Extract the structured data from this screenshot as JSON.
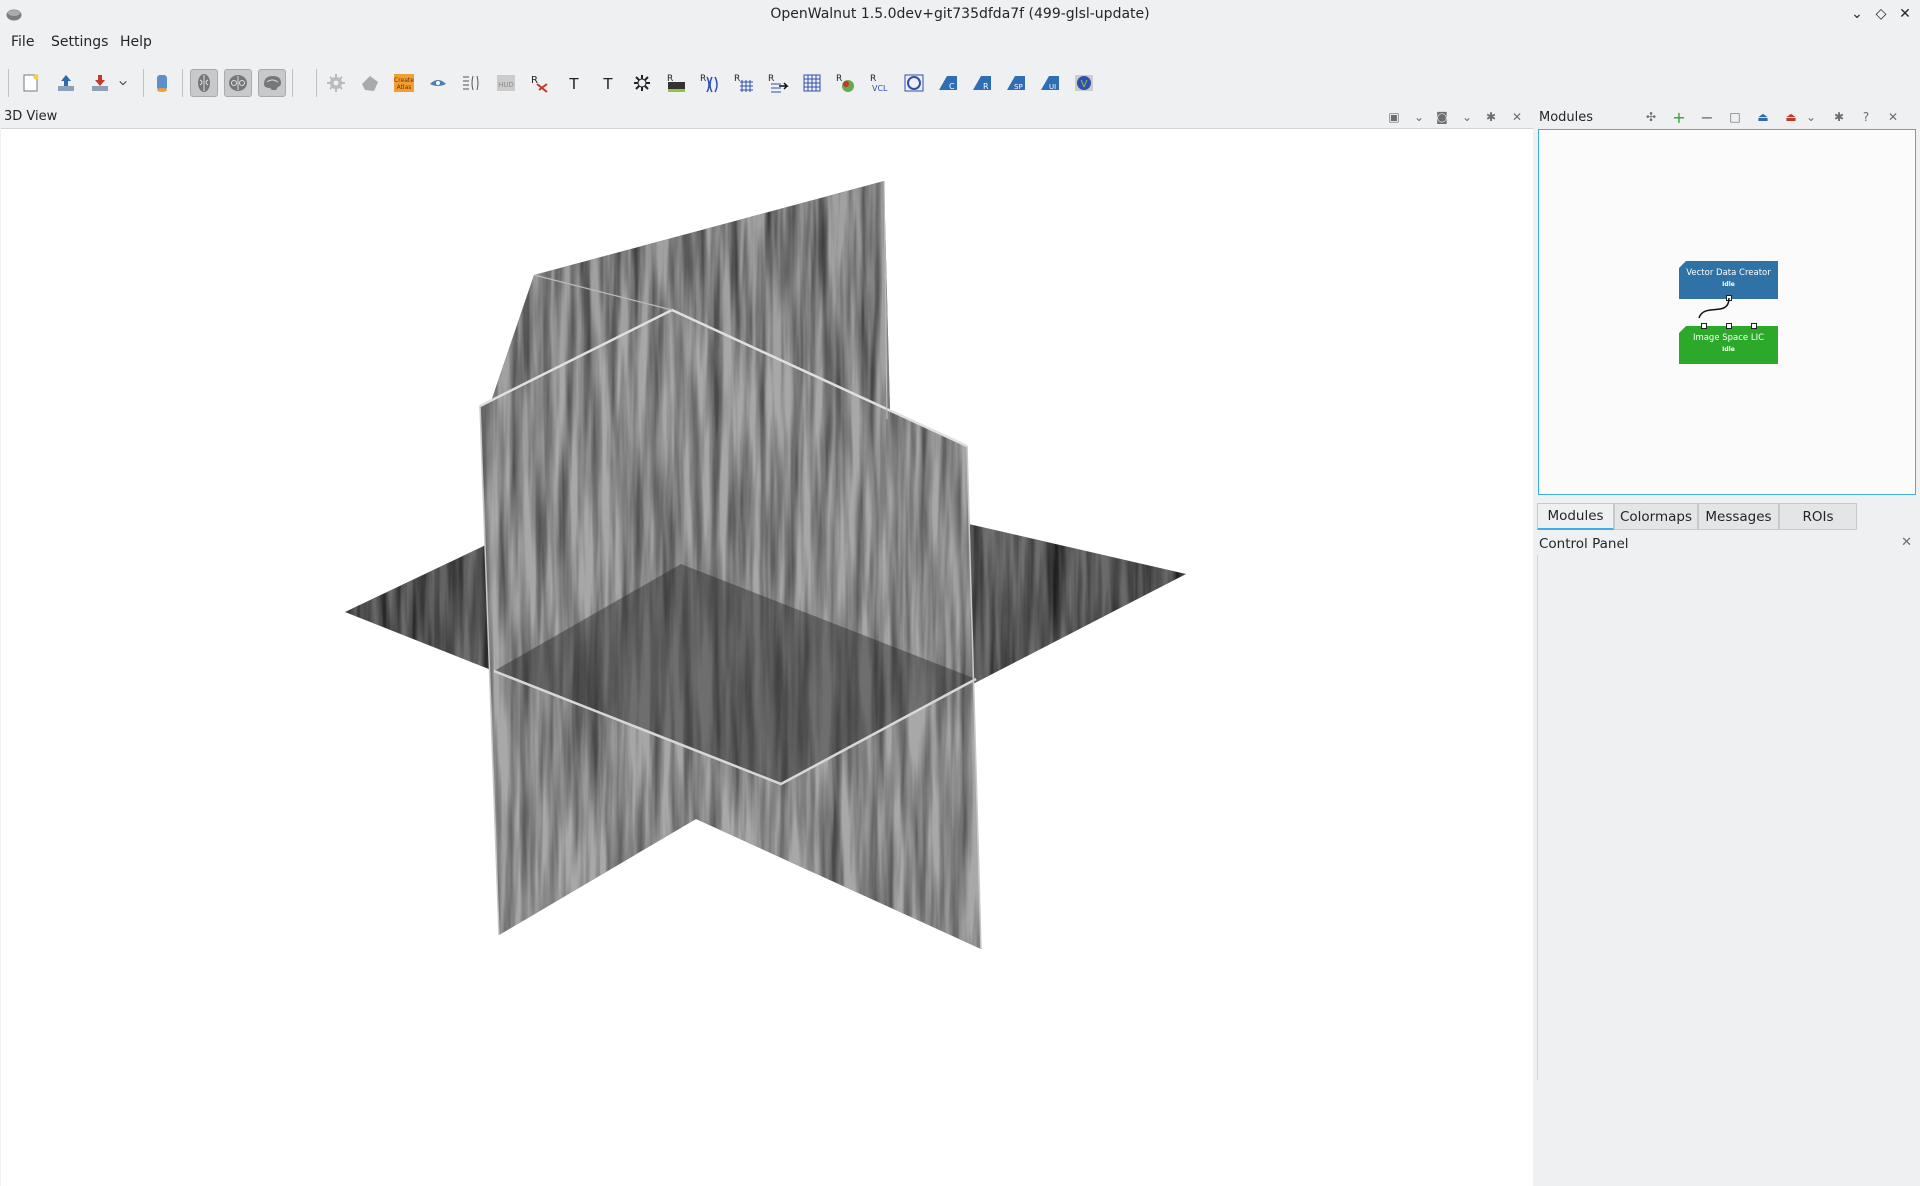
{
  "window": {
    "title": "OpenWalnut 1.5.0dev+git735dfda7f (499-glsl-update)",
    "controls": {
      "minimize": "⌄",
      "maximize": "◇",
      "close": "✕"
    }
  },
  "menu": {
    "items": [
      "File",
      "Settings",
      "Help"
    ]
  },
  "toolbar": {
    "buttons": [
      {
        "icon": "new-project-icon"
      },
      {
        "icon": "load-icon"
      },
      {
        "icon": "save-icon"
      },
      {
        "icon": "dropdown-arrow-icon"
      },
      {
        "icon": "database-icon"
      },
      {
        "icon": "brain-axial-icon",
        "pressed": true
      },
      {
        "icon": "brain-coronal-icon",
        "pressed": true
      },
      {
        "icon": "brain-sagittal-icon",
        "pressed": true
      },
      {
        "icon": "gear-module-icon"
      },
      {
        "icon": "sphere-module-icon"
      },
      {
        "icon": "create-atlas-icon",
        "text": "Create Atlas"
      },
      {
        "icon": "eye-module-icon"
      },
      {
        "icon": "matrix-module-icon"
      },
      {
        "icon": "hud-icon",
        "text": "HUD"
      },
      {
        "icon": "r-fibers-icon",
        "text": "R"
      },
      {
        "icon": "text-icon",
        "text": "T"
      },
      {
        "icon": "text-icon-2",
        "text": "T"
      },
      {
        "icon": "isosurface-icon"
      },
      {
        "icon": "r-image-icon",
        "text": "R"
      },
      {
        "icon": "r-vector-icon",
        "text": "R"
      },
      {
        "icon": "r-grid-icon",
        "text": "R"
      },
      {
        "icon": "r-arrow-icon",
        "text": "R"
      },
      {
        "icon": "grid-icon"
      },
      {
        "icon": "r-cluster-icon",
        "text": "R"
      },
      {
        "icon": "r-vcl-icon",
        "text": "VCL"
      },
      {
        "icon": "dgg-icon"
      },
      {
        "icon": "ic-icon",
        "text": "IC"
      },
      {
        "icon": "ir-icon",
        "text": "IR"
      },
      {
        "icon": "isp-icon",
        "text": "ISP"
      },
      {
        "icon": "iui-icon",
        "text": "IUI"
      },
      {
        "icon": "v-icon",
        "text": "V"
      }
    ]
  },
  "view3d": {
    "title": "3D View"
  },
  "modules_dock": {
    "title": "Modules",
    "nodes": [
      {
        "name": "Vector Data Creator",
        "status": "Idle",
        "color": "#2e72a6"
      },
      {
        "name": "Image Space LIC",
        "status": "Idle",
        "color": "#2ca82b"
      }
    ]
  },
  "tabs": [
    {
      "label": "Modules",
      "active": true
    },
    {
      "label": "Colormaps",
      "active": false
    },
    {
      "label": "Messages",
      "active": false
    },
    {
      "label": "ROIs",
      "active": false
    }
  ],
  "control_panel": {
    "title": "Control Panel"
  },
  "colors": {
    "accent": "#3daee9",
    "node_blue": "#2e72a6",
    "node_green": "#2ca82b"
  }
}
